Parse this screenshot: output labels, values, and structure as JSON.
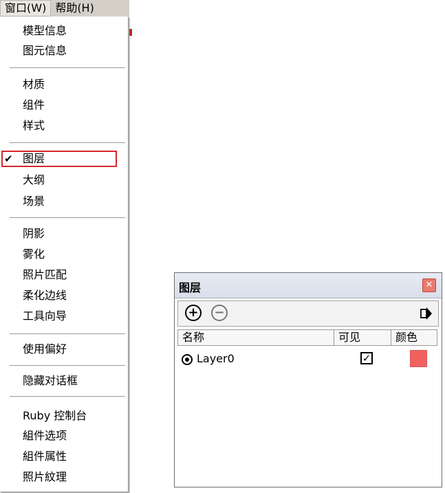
{
  "menubar": {
    "items": [
      {
        "label": "窗口(W)"
      },
      {
        "label": "帮助(H)"
      }
    ]
  },
  "dropdown": {
    "check_mark": "✔",
    "items": [
      {
        "label": "模型信息"
      },
      {
        "label": "图元信息"
      },
      {
        "label": "材质"
      },
      {
        "label": "组件"
      },
      {
        "label": "样式"
      },
      {
        "label": "图层",
        "checked": true
      },
      {
        "label": "大纲"
      },
      {
        "label": "场景"
      },
      {
        "label": "阴影"
      },
      {
        "label": "雾化"
      },
      {
        "label": "照片匹配"
      },
      {
        "label": "柔化边线"
      },
      {
        "label": "工具向导"
      },
      {
        "label": "使用偏好"
      },
      {
        "label": "隐藏对话框"
      },
      {
        "label": "Ruby 控制台"
      },
      {
        "label": "組件选项"
      },
      {
        "label": "組件属性"
      },
      {
        "label": "照片紋理"
      }
    ]
  },
  "layers_dialog": {
    "title": "图层",
    "close_glyph": "✕",
    "toolbar": {
      "add_glyph": "+",
      "delete_glyph": "−"
    },
    "columns": {
      "name": "名称",
      "visible": "可见",
      "color": "颜色"
    },
    "rows": [
      {
        "name": "Layer0",
        "visible_glyph": "✓",
        "color": "#f26060"
      }
    ]
  },
  "colors": {
    "highlight": "#d9252a",
    "layer_color": "#f26060"
  }
}
